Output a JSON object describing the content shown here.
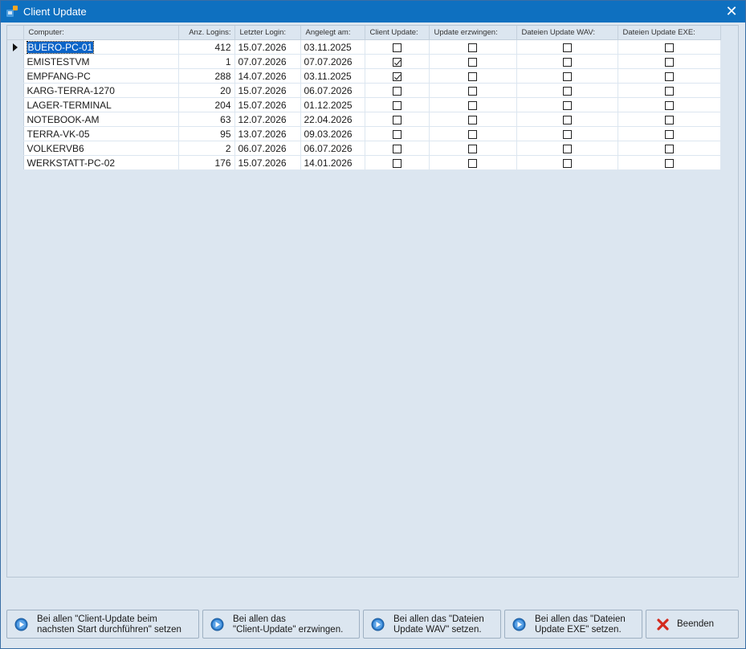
{
  "window": {
    "title": "Client Update",
    "close_glyph": "✕"
  },
  "grid": {
    "columns": [
      "Computer:",
      "Anz. Logins:",
      "Letzter Login:",
      "Angelegt am:",
      "Client Update:",
      "Update erzwingen:",
      "Dateien Update WAV:",
      "Dateien Update EXE:"
    ],
    "rows": [
      {
        "computer": "BUERO-PC-01",
        "logins": "412",
        "last": "15.07.2026",
        "created": "03.11.2025",
        "client": false,
        "force": false,
        "wav": false,
        "exe": false
      },
      {
        "computer": "EMISTESTVM",
        "logins": "1",
        "last": "07.07.2026",
        "created": "07.07.2026",
        "client": true,
        "force": false,
        "wav": false,
        "exe": false
      },
      {
        "computer": "EMPFANG-PC",
        "logins": "288",
        "last": "14.07.2026",
        "created": "03.11.2025",
        "client": true,
        "force": false,
        "wav": false,
        "exe": false
      },
      {
        "computer": "KARG-TERRA-1270",
        "logins": "20",
        "last": "15.07.2026",
        "created": "06.07.2026",
        "client": false,
        "force": false,
        "wav": false,
        "exe": false
      },
      {
        "computer": "LAGER-TERMINAL",
        "logins": "204",
        "last": "15.07.2026",
        "created": "01.12.2025",
        "client": false,
        "force": false,
        "wav": false,
        "exe": false
      },
      {
        "computer": "NOTEBOOK-AM",
        "logins": "63",
        "last": "12.07.2026",
        "created": "22.04.2026",
        "client": false,
        "force": false,
        "wav": false,
        "exe": false
      },
      {
        "computer": "TERRA-VK-05",
        "logins": "95",
        "last": "13.07.2026",
        "created": "09.03.2026",
        "client": false,
        "force": false,
        "wav": false,
        "exe": false
      },
      {
        "computer": "VOLKERVB6",
        "logins": "2",
        "last": "06.07.2026",
        "created": "06.07.2026",
        "client": false,
        "force": false,
        "wav": false,
        "exe": false
      },
      {
        "computer": "WERKSTATT-PC-02",
        "logins": "176",
        "last": "15.07.2026",
        "created": "14.01.2026",
        "client": false,
        "force": false,
        "wav": false,
        "exe": false
      }
    ],
    "selected_row": 0
  },
  "buttons": [
    {
      "label": "Bei allen \"Client-Update beim\nnachsten Start durchführen\" setzen",
      "icon": "play-icon"
    },
    {
      "label": "Bei allen das\n\"Client-Update\" erzwingen.",
      "icon": "play-icon"
    },
    {
      "label": "Bei allen das \"Dateien\nUpdate WAV\" setzen.",
      "icon": "play-icon"
    },
    {
      "label": "Bei allen das \"Dateien\nUpdate EXE\" setzen.",
      "icon": "play-icon"
    },
    {
      "label": "Beenden",
      "icon": "red-x-icon"
    }
  ],
  "colors": {
    "titlebar": "#0e70c0",
    "background": "#dce6f0",
    "selection": "#0a64c8",
    "icon_blue": "#2a78c8",
    "icon_red": "#d42a1e"
  }
}
